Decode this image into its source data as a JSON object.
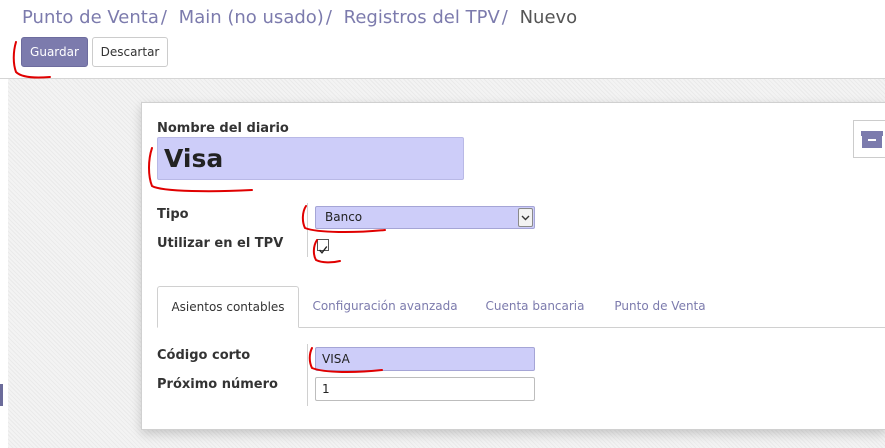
{
  "breadcrumb": {
    "items": [
      "Punto de Venta",
      "Main (no usado)",
      "Registros del TPV"
    ],
    "separator": "/",
    "current": "Nuevo"
  },
  "toolbar": {
    "save_label": "Guardar",
    "discard_label": "Descartar"
  },
  "form": {
    "name_label": "Nombre del diario",
    "name_value": "Visa",
    "type_label": "Tipo",
    "type_value": "Banco",
    "pos_label": "Utilizar en el TPV",
    "pos_checked": true,
    "archive_icon": "archive-icon"
  },
  "tabs": [
    {
      "label": "Asientos contables",
      "active": true
    },
    {
      "label": "Configuración avanzada",
      "active": false
    },
    {
      "label": "Cuenta bancaria",
      "active": false
    },
    {
      "label": "Punto de Venta",
      "active": false
    }
  ],
  "tab_content": {
    "code_label": "Código corto",
    "code_value": "VISA",
    "next_label": "Próximo número",
    "next_value": "1"
  },
  "colors": {
    "accent": "#7c7bad",
    "required_field": "#cdcdf9",
    "annotation": "#e00000"
  }
}
